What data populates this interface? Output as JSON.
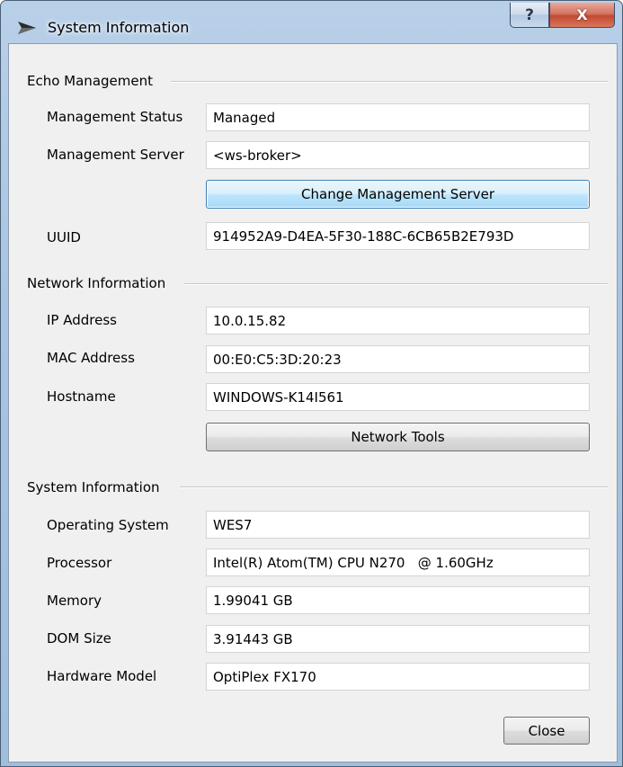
{
  "window": {
    "title": "System Information",
    "help_label": "?",
    "close_label": "X"
  },
  "echo": {
    "heading": "Echo Management",
    "status_label": "Management Status",
    "status_value": "Managed",
    "server_label": "Management Server",
    "server_value": "<ws-broker>",
    "change_button": "Change Management Server",
    "uuid_label": "UUID",
    "uuid_value": "914952A9-D4EA-5F30-188C-6CB65B2E793D"
  },
  "network": {
    "heading": "Network Information",
    "ip_label": "IP Address",
    "ip_value": "10.0.15.82",
    "mac_label": "MAC Address",
    "mac_value": "00:E0:C5:3D:20:23",
    "hostname_label": "Hostname",
    "hostname_value": "WINDOWS-K14I561",
    "tools_button": "Network Tools"
  },
  "system": {
    "heading": "System Information",
    "os_label": "Operating System",
    "os_value": "WES7",
    "processor_label": "Processor",
    "processor_value": "Intel(R) Atom(TM) CPU N270   @ 1.60GHz",
    "memory_label": "Memory",
    "memory_value": "1.99041 GB",
    "dom_label": "DOM Size",
    "dom_value": "3.91443 GB",
    "model_label": "Hardware Model",
    "model_value": "OptiPlex FX170"
  },
  "footer": {
    "close_button": "Close"
  }
}
